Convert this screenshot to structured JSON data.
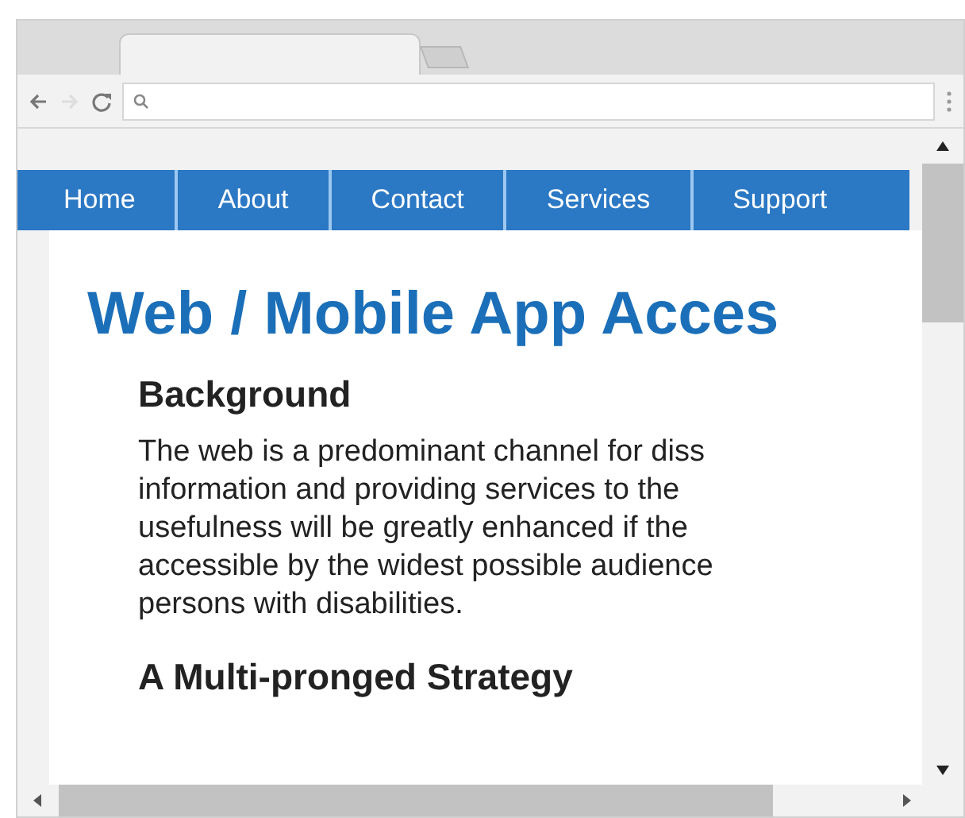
{
  "nav": [
    {
      "label": "Home"
    },
    {
      "label": "About"
    },
    {
      "label": "Contact"
    },
    {
      "label": "Services"
    },
    {
      "label": "Support"
    }
  ],
  "page": {
    "title": "Web / Mobile App Acces",
    "heading": "Background",
    "paragraph_lines": [
      "The web is a predominant channel for diss",
      "information and providing services to the",
      "usefulness will be greatly enhanced if the",
      "accessible by the widest possible audience",
      "persons with disabilities."
    ],
    "heading_2": "A Multi-pronged Strategy"
  }
}
